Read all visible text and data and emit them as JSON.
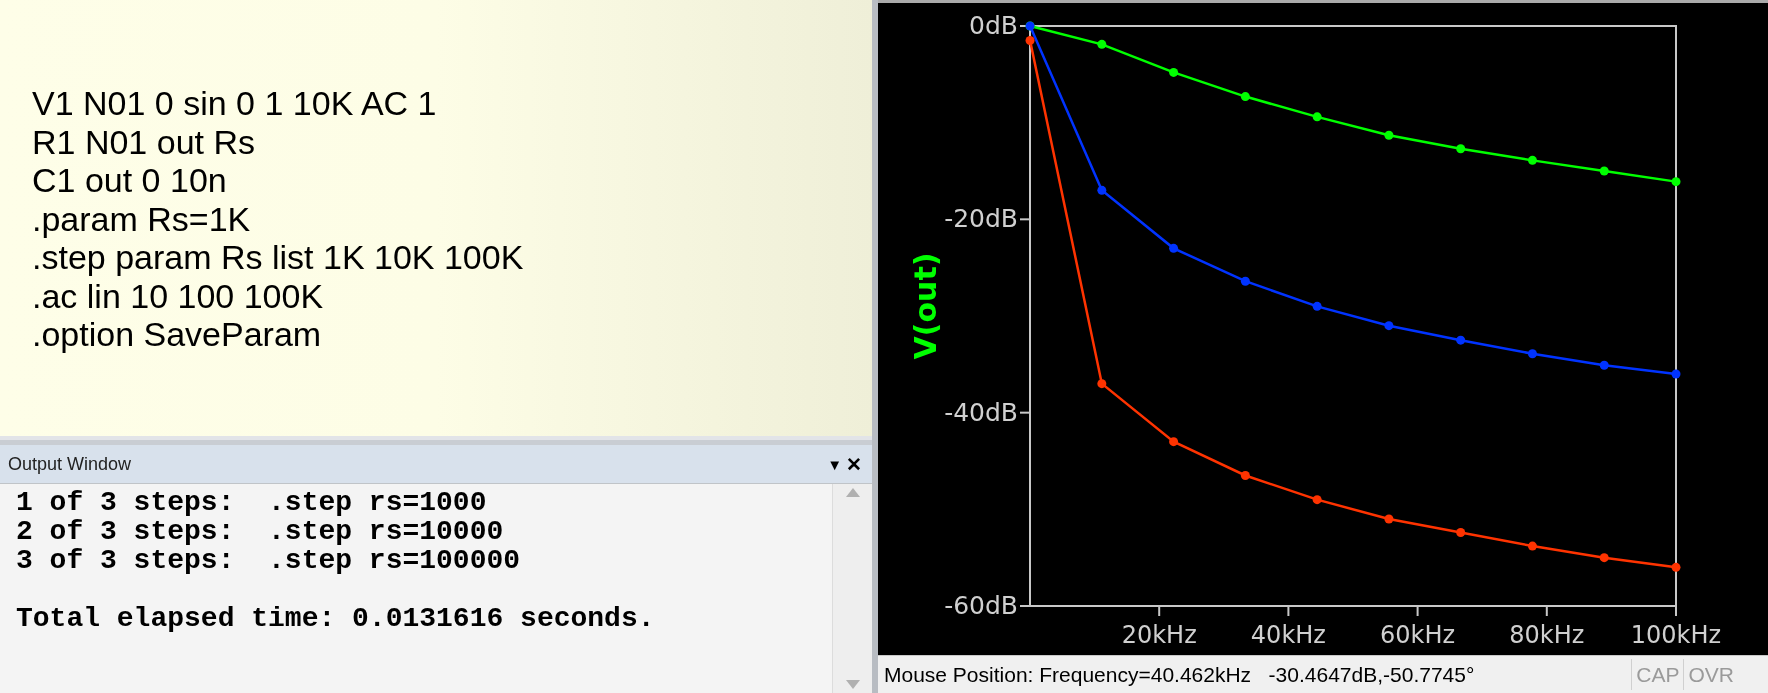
{
  "netlist": {
    "lines": [
      "V1 N01 0 sin 0 1 10K AC 1",
      "R1 N01 out Rs",
      "C1 out 0 10n",
      ".param Rs=1K",
      ".step param Rs list 1K 10K 100K",
      ".ac lin 10 100 100K",
      ".option SaveParam"
    ]
  },
  "output_window": {
    "title": "Output Window",
    "menu_glyph": "▼",
    "close_glyph": "✕",
    "lines": [
      "1 of 3 steps:  .step rs=1000",
      "2 of 3 steps:  .step rs=10000",
      "3 of 3 steps:  .step rs=100000"
    ],
    "summary": "Total elapsed time: 0.0131616 seconds."
  },
  "plot": {
    "chart_data": {
      "type": "line",
      "ylabel": "V(out)",
      "x": [
        0.01,
        11.12,
        22.23,
        33.34,
        44.45,
        55.56,
        66.67,
        77.78,
        88.89,
        100
      ],
      "xlim": [
        0,
        100
      ],
      "ylim": [
        -60,
        0
      ],
      "xticks": [
        {
          "value": 20,
          "label": "20kHz"
        },
        {
          "value": 40,
          "label": "40kHz"
        },
        {
          "value": 60,
          "label": "60kHz"
        },
        {
          "value": 80,
          "label": "80kHz"
        },
        {
          "value": 100,
          "label": "100kHz"
        }
      ],
      "yticks": [
        {
          "value": 0,
          "label": "0dB"
        },
        {
          "value": -20,
          "label": "-20dB"
        },
        {
          "value": -40,
          "label": "-40dB"
        },
        {
          "value": -60,
          "label": "-60dB"
        }
      ],
      "series": [
        {
          "color": "#00ff00",
          "marker": "circle",
          "values": [
            0,
            -1.9,
            -4.8,
            -7.3,
            -9.4,
            -11.3,
            -12.7,
            -13.9,
            -15.0,
            -16.1
          ]
        },
        {
          "color": "#0033ff",
          "marker": "circle",
          "values": [
            0,
            -17.0,
            -23.0,
            -26.4,
            -29.0,
            -31.0,
            -32.5,
            -33.9,
            -35.1,
            -36.0
          ]
        },
        {
          "color": "#ff3300",
          "marker": "circle",
          "values": [
            -1.5,
            -37.0,
            -43.0,
            -46.5,
            -49.0,
            -51.0,
            -52.4,
            -53.8,
            -55.0,
            -56.0
          ]
        }
      ]
    }
  },
  "status_bar": {
    "text": "Mouse Position: Frequency=40.462kHz   -30.4647dB,-50.7745°",
    "indicators": [
      {
        "label": "CAP",
        "on": false
      },
      {
        "label": "OVR",
        "on": false
      }
    ]
  }
}
